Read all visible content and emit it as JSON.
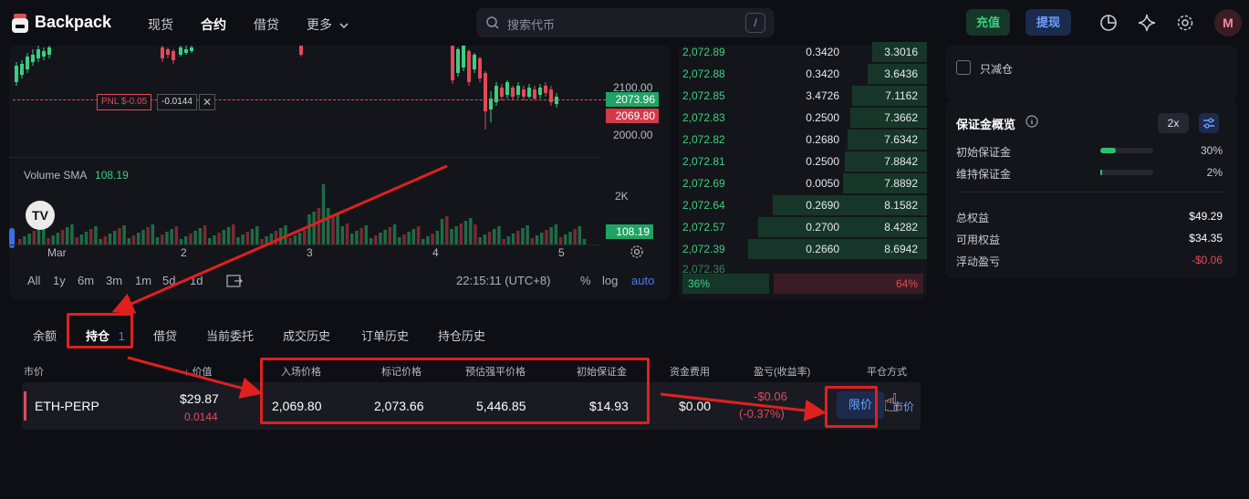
{
  "app": {
    "name": "Backpack"
  },
  "nav": [
    {
      "label": "现货",
      "active": false
    },
    {
      "label": "合约",
      "active": true
    },
    {
      "label": "借贷",
      "active": false
    },
    {
      "label": "更多",
      "active": false
    }
  ],
  "search": {
    "placeholder": "搜索代币",
    "shortcut": "/"
  },
  "header_actions": {
    "deposit": "充值",
    "withdraw": "提现",
    "avatar": "M"
  },
  "chart": {
    "pnl_label": "PNL $-0.05",
    "pnl_qty": "-0.0144",
    "price_2100": "2100.00",
    "price_2000": "2000.00",
    "last_price": "2073.96",
    "entry_price": "2069.80",
    "volume_label": "Volume SMA",
    "volume_value": "108.19",
    "vol_2k": "2K",
    "vol_tag": "108.19",
    "x_ticks": [
      "Mar",
      "2",
      "3",
      "4",
      "5"
    ],
    "timeframes": [
      "All",
      "1y",
      "6m",
      "3m",
      "1m",
      "5d",
      "1d"
    ],
    "clock": "22:15:11 (UTC+8)",
    "pct": "%",
    "log": "log",
    "auto": "auto",
    "accent_up": "#3ad07f",
    "accent_down": "#e24a58"
  },
  "orderbook": {
    "rows": [
      {
        "price": "2,072.89",
        "size": "0.3420",
        "total": "3.3016",
        "fill": 0.22
      },
      {
        "price": "2,072.88",
        "size": "0.3420",
        "total": "3.6436",
        "fill": 0.24
      },
      {
        "price": "2,072.85",
        "size": "3.4726",
        "total": "7.1162",
        "fill": 0.3
      },
      {
        "price": "2,072.83",
        "size": "0.2500",
        "total": "7.3662",
        "fill": 0.31
      },
      {
        "price": "2,072.82",
        "size": "0.2680",
        "total": "7.6342",
        "fill": 0.32
      },
      {
        "price": "2,072.81",
        "size": "0.2500",
        "total": "7.8842",
        "fill": 0.33
      },
      {
        "price": "2,072.69",
        "size": "0.0050",
        "total": "7.8892",
        "fill": 0.34
      },
      {
        "price": "2,072.64",
        "size": "0.2690",
        "total": "8.1582",
        "fill": 0.62
      },
      {
        "price": "2,072.57",
        "size": "0.2700",
        "total": "8.4282",
        "fill": 0.68
      },
      {
        "price": "2,072.39",
        "size": "0.2660",
        "total": "8.6942",
        "fill": 0.72
      }
    ],
    "partial_row": "2,072.36",
    "buy_pct": "36%",
    "sell_pct": "64%",
    "buy_ratio": 0.36
  },
  "reduce_only": {
    "label": "只减仓"
  },
  "margin": {
    "title": "保证金概览",
    "leverage": "2x",
    "initial_label": "初始保证金",
    "initial_pct": "30%",
    "initial_ratio": 0.3,
    "maint_label": "维持保证金",
    "maint_pct": "2%",
    "maint_ratio": 0.02,
    "equity_label": "总权益",
    "equity": "$49.29",
    "available_label": "可用权益",
    "available": "$34.35",
    "unrealized_label": "浮动盈亏",
    "unrealized": "-$0.06"
  },
  "bottom": {
    "tabs": [
      {
        "label": "余额"
      },
      {
        "label": "持仓",
        "badge": "1",
        "active": true
      },
      {
        "label": "借贷"
      },
      {
        "label": "当前委托"
      },
      {
        "label": "成交历史"
      },
      {
        "label": "订单历史"
      },
      {
        "label": "持仓历史"
      }
    ],
    "headers": {
      "market": "市价",
      "value": "价值",
      "entry": "入场价格",
      "mark": "标记价格",
      "liq": "预估强平价格",
      "init_margin": "初始保证金",
      "funding": "资金费用",
      "pnl": "盈亏(收益率)",
      "close": "平仓方式"
    },
    "position": {
      "symbol": "ETH-PERP",
      "value": "$29.87",
      "qty": "0.0144",
      "entry": "2,069.80",
      "mark": "2,073.66",
      "liq": "5,446.85",
      "init_margin": "$14.93",
      "funding": "$0.00",
      "pnl": "-$0.06",
      "pnl_pct": "(-0.37%)",
      "limit_btn": "限价",
      "market_btn": "市价"
    }
  }
}
